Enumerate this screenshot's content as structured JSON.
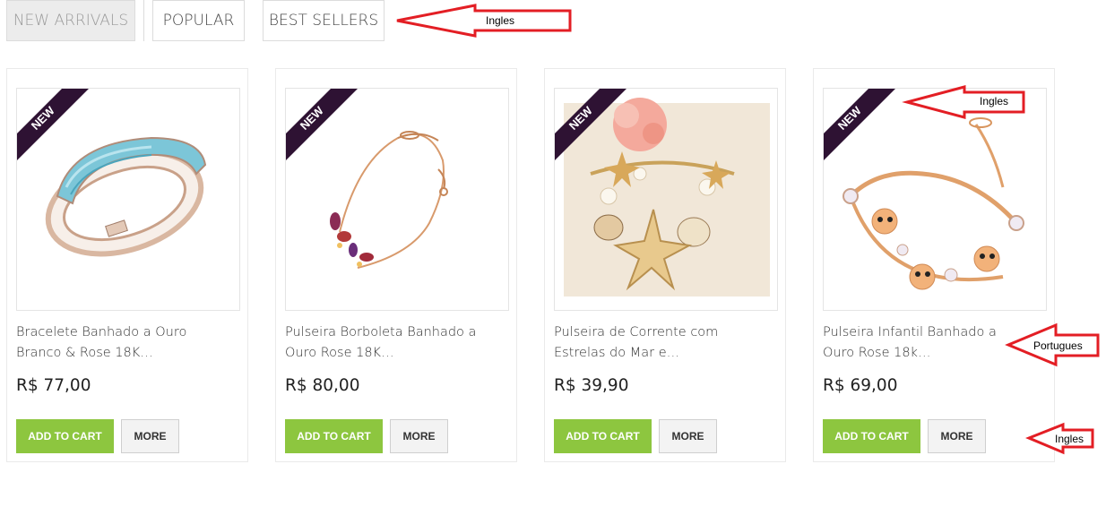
{
  "tabs": [
    {
      "label": "NEW ARRIVALS",
      "active": true
    },
    {
      "label": "POPULAR",
      "active": false
    },
    {
      "label": "BEST SELLERS",
      "active": false
    }
  ],
  "badge_text": "NEW",
  "colors": {
    "badge": "#2e1233",
    "cart_button": "#8dc63f",
    "annotation_arrow": "#e31e24"
  },
  "products": [
    {
      "title_line1": "Bracelete Banhado a Ouro",
      "title_line2": "Branco & Rose 18K…",
      "price": "R$ 77,00",
      "image_icon": "turquoise-bangle-image"
    },
    {
      "title_line1": "Pulseira Borboleta Banhado a",
      "title_line2": "Ouro Rose 18K…",
      "price": "R$ 80,00",
      "image_icon": "butterfly-chain-bracelet-image"
    },
    {
      "title_line1": "Pulseira de Corrente com",
      "title_line2": "Estrelas do Mar e…",
      "price": "R$ 39,90",
      "image_icon": "starfish-charm-bracelet-image"
    },
    {
      "title_line1": "Pulseira Infantil Banhado a",
      "title_line2": "Ouro Rose 18k…",
      "price": "R$ 69,00",
      "image_icon": "octopus-charm-bracelet-image"
    }
  ],
  "buttons": {
    "add_to_cart": "ADD TO CART",
    "more": "MORE"
  },
  "annotations": [
    {
      "label": "Ingles"
    },
    {
      "label": "Ingles"
    },
    {
      "label": "Portugues"
    },
    {
      "label": "Ingles"
    }
  ]
}
